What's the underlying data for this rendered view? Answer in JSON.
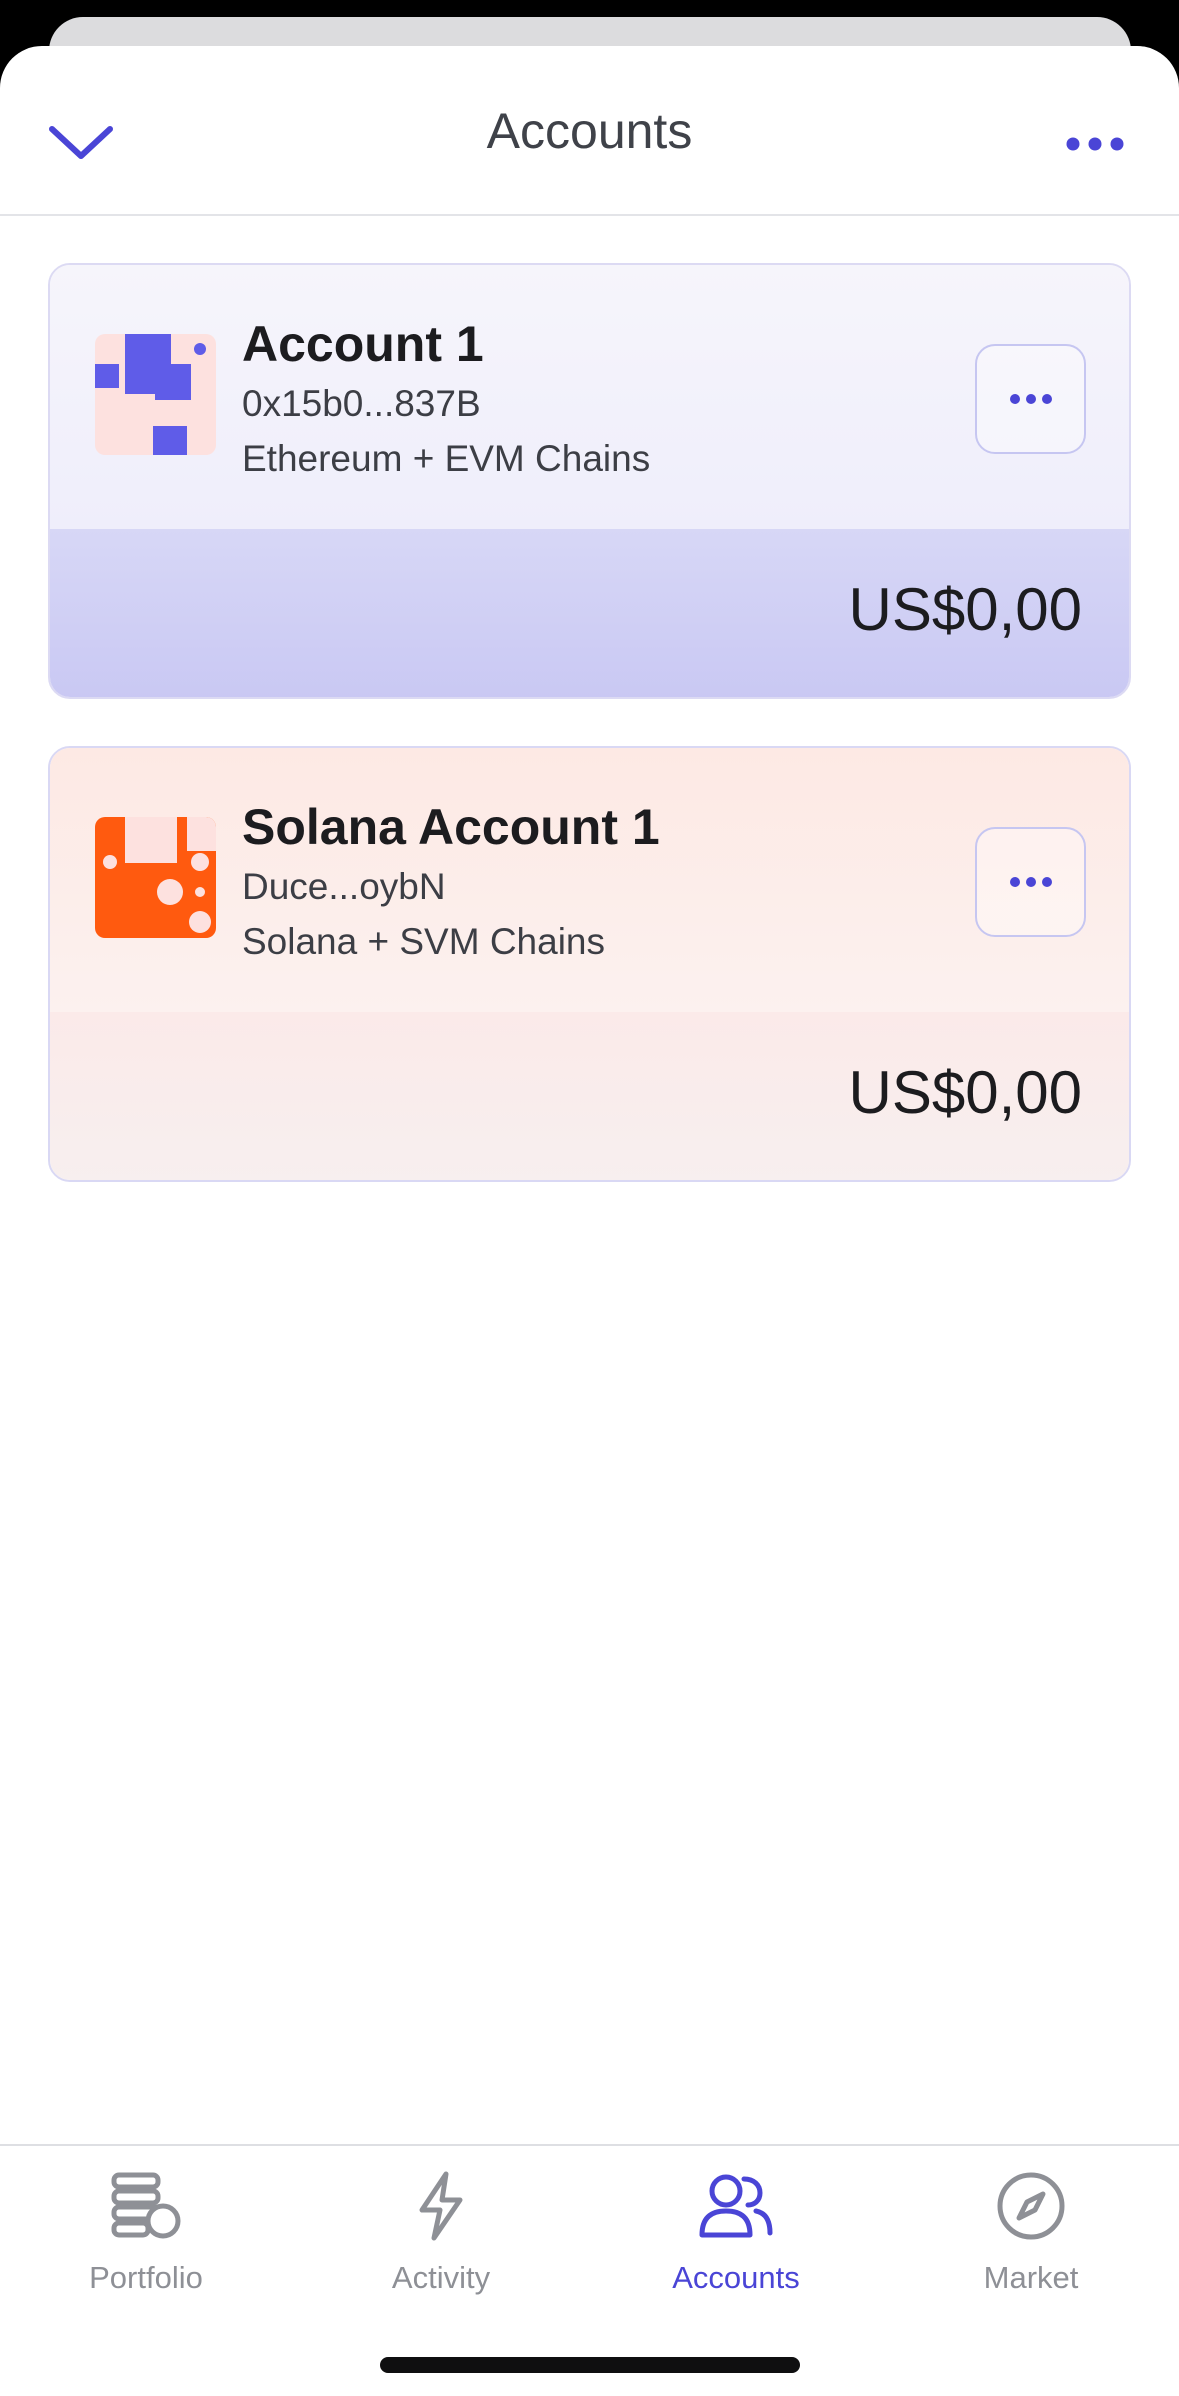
{
  "header": {
    "title": "Accounts"
  },
  "accounts": [
    {
      "name": "Account 1",
      "address": "0x15b0...837B",
      "chains": "Ethereum + EVM Chains",
      "balance": "US$0,00"
    },
    {
      "name": "Solana Account 1",
      "address": "Duce...oybN",
      "chains": "Solana + SVM Chains",
      "balance": "US$0,00"
    }
  ],
  "tabs": [
    {
      "label": "Portfolio",
      "icon": "portfolio-icon",
      "active": false
    },
    {
      "label": "Activity",
      "icon": "lightning-icon",
      "active": false
    },
    {
      "label": "Accounts",
      "icon": "users-icon",
      "active": true
    },
    {
      "label": "Market",
      "icon": "compass-icon",
      "active": false
    }
  ],
  "colors": {
    "accent": "#4a45d6",
    "tab_inactive": "#8e9096",
    "solana_orange": "#ff5a0f",
    "evm_purple": "#5f5ce8"
  }
}
